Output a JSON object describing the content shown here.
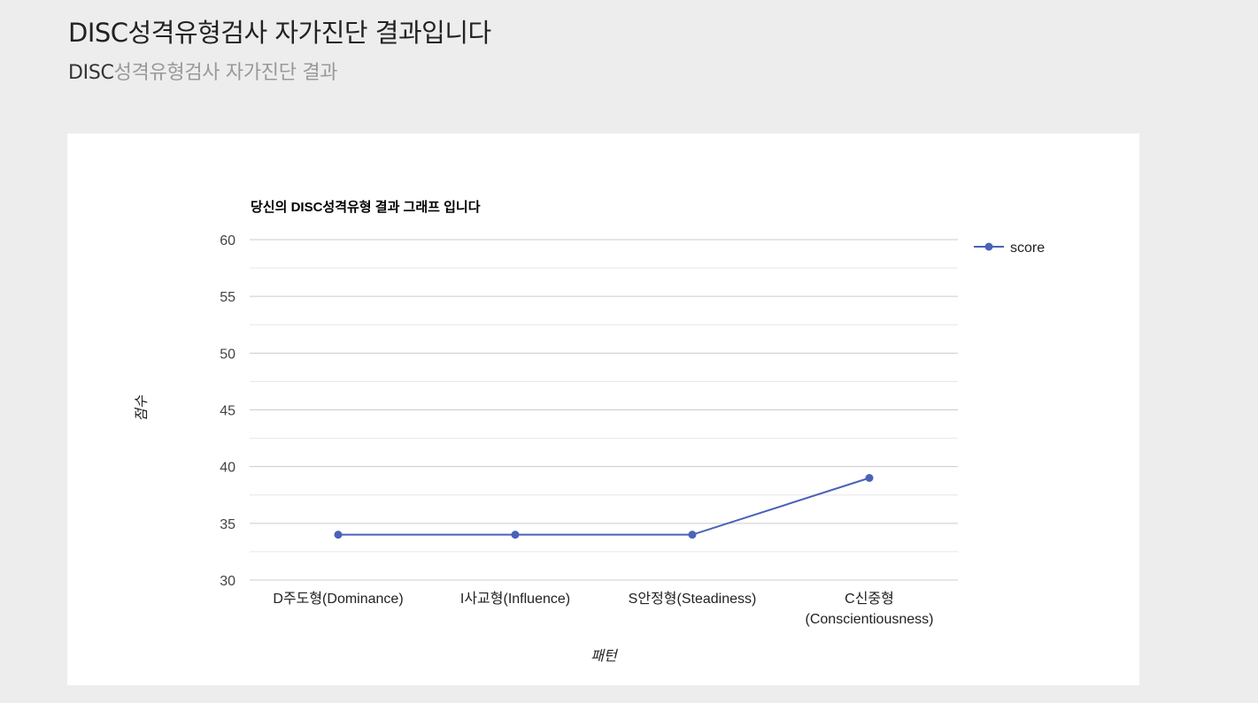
{
  "header": {
    "title": "DISC성격유형검사 자가진단 결과입니다",
    "subtitle_prefix": "DISC",
    "subtitle_rest": "성격유형검사 자가진단 결과"
  },
  "colors": {
    "page_background": "#ededed",
    "card_background": "#ffffff",
    "series": "#4a62b8",
    "gridline_major": "#cccccc",
    "gridline_minor": "#e6e6e6"
  },
  "chart_data": {
    "type": "line",
    "title": "당신의 DISC성격유형 결과 그래프 입니다",
    "xlabel": "패턴",
    "ylabel": "점수",
    "categories": [
      [
        "D주도형(Dominance)"
      ],
      [
        "I사교형(Influence)"
      ],
      [
        "S안정형(Steadiness)"
      ],
      [
        "C신중형",
        "(Conscientiousness)"
      ]
    ],
    "series": [
      {
        "name": "score",
        "values": [
          34,
          34,
          34,
          39
        ]
      }
    ],
    "ylim": [
      30,
      60
    ],
    "yticks": [
      30,
      35,
      40,
      45,
      50,
      55,
      60
    ],
    "grid": true,
    "legend": "right",
    "marker": "circle"
  }
}
